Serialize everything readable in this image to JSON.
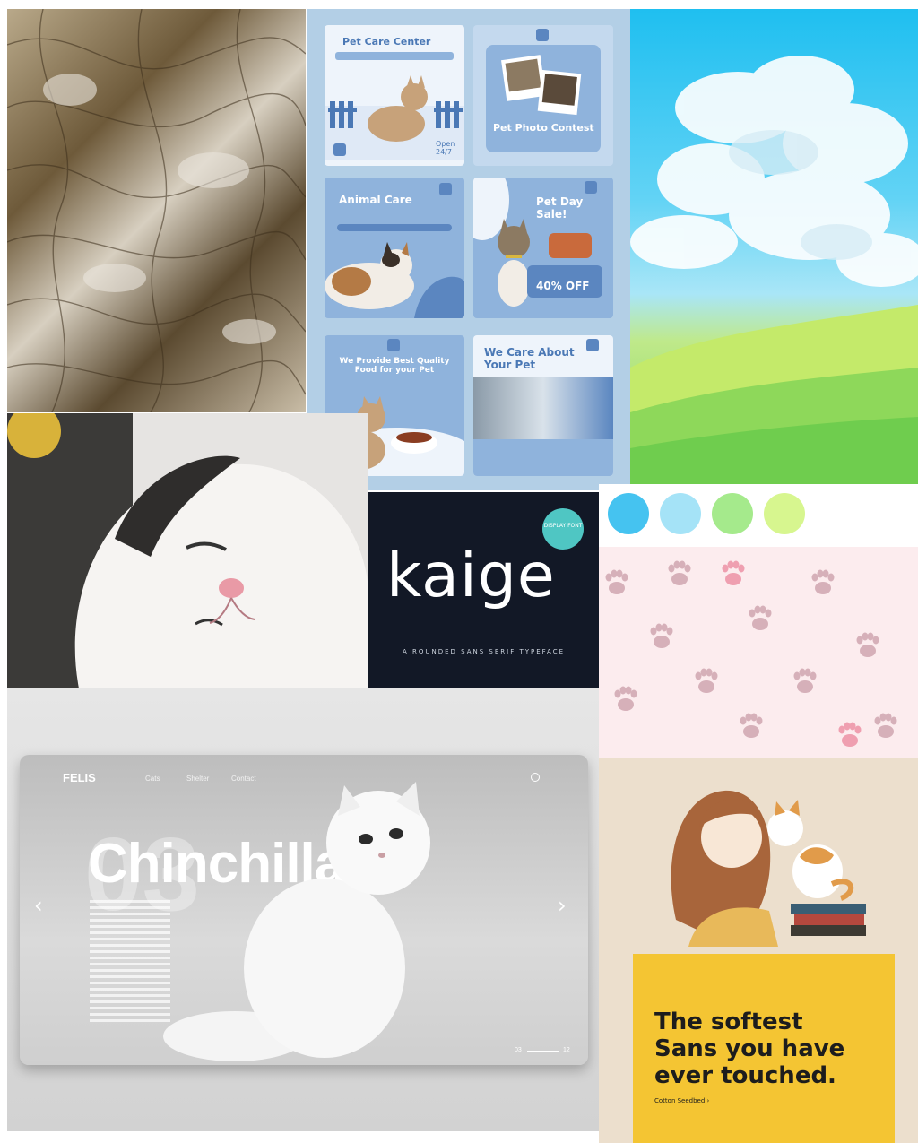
{
  "pet_posts": {
    "care_center": {
      "title": "Pet Care Center",
      "open": "Open 24/7"
    },
    "photo_contest": {
      "title": "Pet Photo Contest"
    },
    "animal_care": {
      "title": "Animal Care"
    },
    "pet_day": {
      "title": "Pet Day Sale!",
      "discount": "40% OFF"
    },
    "quality_food": {
      "title": "We Provide Best Quality Food for your Pet"
    },
    "we_care": {
      "title": "We Care About Your Pet"
    }
  },
  "kaige": {
    "word": "kaige",
    "badge": "DISPLAY FONT",
    "subtitle": "A ROUNDED SANS SERIF TYPEFACE"
  },
  "palette": {
    "colors": [
      "#45c3f0",
      "#a5e3f7",
      "#a5ea8c",
      "#d7f68f"
    ]
  },
  "felis": {
    "brand": "FELIS",
    "nav": [
      "Cats",
      "Shelter",
      "Contact"
    ],
    "bg_number": "03",
    "title": "Chinchilla",
    "prev": "‹",
    "next": "›",
    "page_current": "03",
    "page_total": "12"
  },
  "softest": {
    "headline_1": "The softest",
    "headline_2": "Sans you have",
    "headline_3": "ever touched.",
    "link": "Cotton Seedbed  ›"
  },
  "colors": {
    "pet_bg": "#b3cfe6",
    "card": "#8fb3dc",
    "kaige_bg": "#121826",
    "kaige_badge": "#4fc6c3",
    "softest_bg": "#f4c533"
  }
}
